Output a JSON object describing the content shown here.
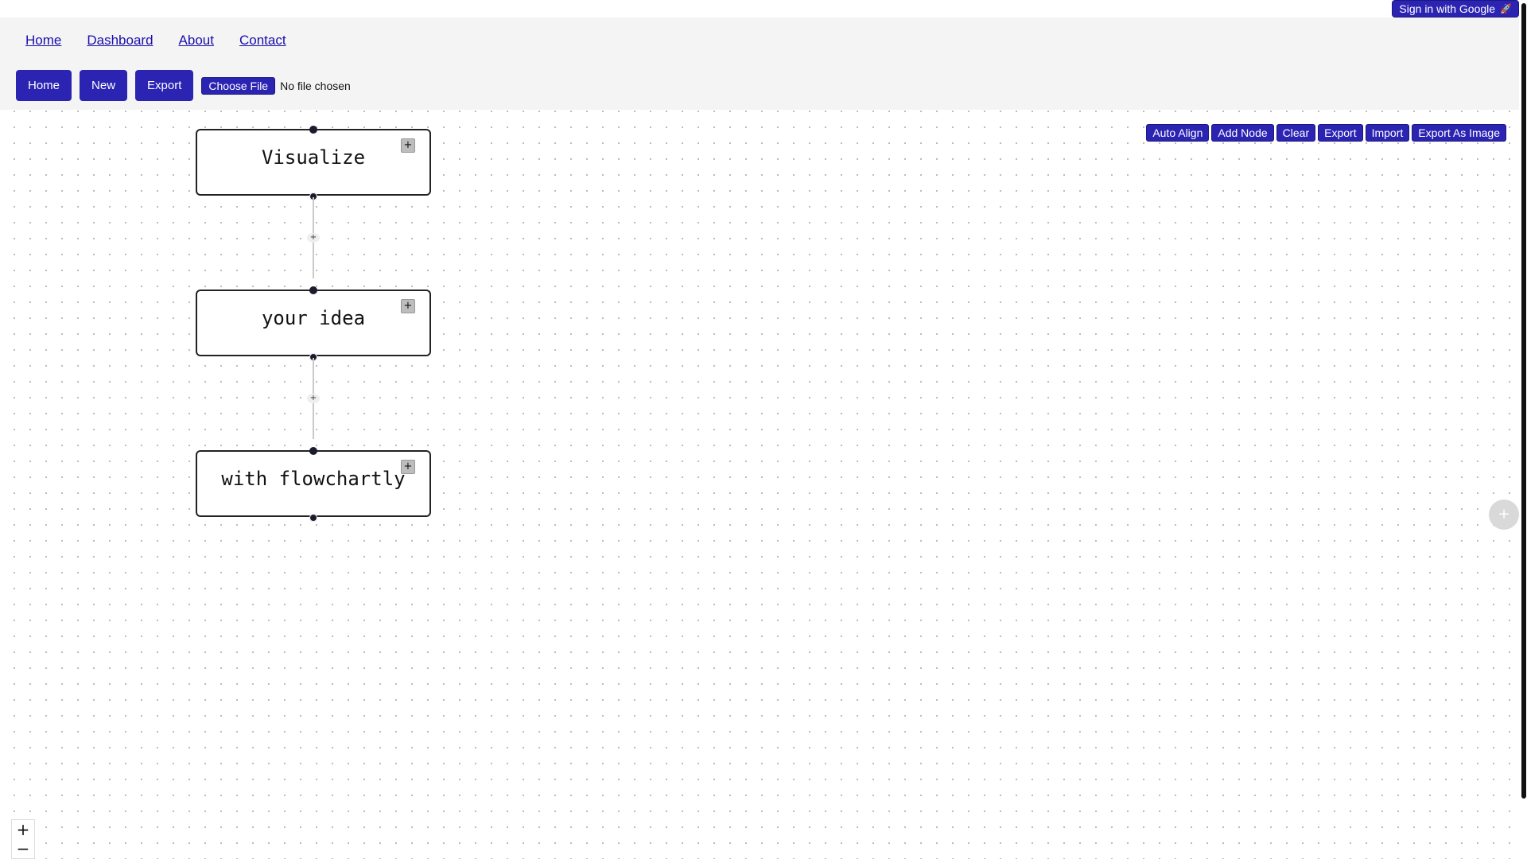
{
  "auth": {
    "signin_label": "Sign in with Google",
    "signin_icon": "rocket-icon"
  },
  "nav": {
    "items": [
      {
        "label": "Home"
      },
      {
        "label": "Dashboard"
      },
      {
        "label": "About"
      },
      {
        "label": "Contact"
      }
    ]
  },
  "toolbar": {
    "home_label": "Home",
    "new_label": "New",
    "export_label": "Export",
    "file_button_label": "Choose File",
    "file_status": "No file chosen"
  },
  "canvas_tools": {
    "items": [
      {
        "label": "Auto Align"
      },
      {
        "label": "Add Node"
      },
      {
        "label": "Clear"
      },
      {
        "label": "Export"
      },
      {
        "label": "Import"
      },
      {
        "label": "Export As Image"
      }
    ]
  },
  "nodes": [
    {
      "label": "Visualize",
      "add_symbol": "+"
    },
    {
      "label": "your idea",
      "add_symbol": "+"
    },
    {
      "label": "with flowchartly",
      "add_symbol": "+"
    }
  ],
  "edges": [
    {
      "symbol": "+"
    },
    {
      "symbol": "+"
    }
  ],
  "fab": {
    "symbol": "+"
  },
  "zoom": {
    "in_symbol": "+",
    "out_symbol": "−"
  },
  "colors": {
    "accent": "#2b24b3",
    "header_bg": "#f4f4f4",
    "link": "#1a0dab",
    "node_border": "#222222"
  }
}
